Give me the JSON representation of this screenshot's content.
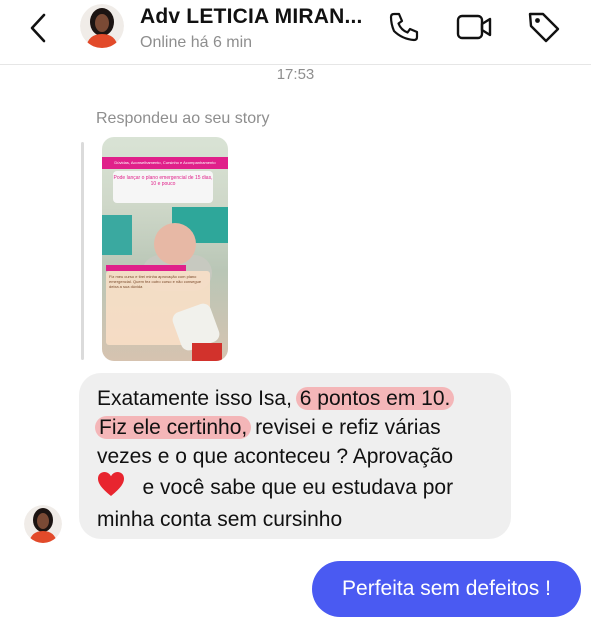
{
  "header": {
    "title": "Adv LETICIA MIRAN...",
    "status": "Online há 6 min",
    "icons": [
      "back-chevron-icon",
      "phone-icon",
      "video-camera-icon",
      "tag-icon"
    ]
  },
  "chat": {
    "timestamp": "17:53",
    "story_reply_label": "Respondeu ao seu story",
    "story": {
      "strip_text": "Dúvidas, Aconselhamento, Cursinho e Acompanhamento",
      "box_text": "Pode lançar o plano emergencial de 15 dias, 10 e pouco",
      "overlay_text": "Fiz meu curso e tirei minha aprovação com plano emergencial. Quem fez outro curso e não consegue deixa a sua dúvida"
    },
    "incoming_message": {
      "line1_plain": "Exatamente isso Isa, ",
      "line1_highlight": "6 pontos em 10.",
      "line2_highlight": "Fiz ele certinho,",
      "line2_plain": " revisei e refiz várias",
      "line3": "vezes e o que aconteceu ? Aprovação",
      "line4_after_heart": "e você sabe que eu estudava por",
      "line5": "minha conta sem cursinho",
      "highlight_color": "#f4b6b8",
      "heart_icon": "red-heart-icon"
    },
    "outgoing_message": {
      "text": "Perfeita sem defeitos !",
      "color": "#4a5af2"
    }
  }
}
